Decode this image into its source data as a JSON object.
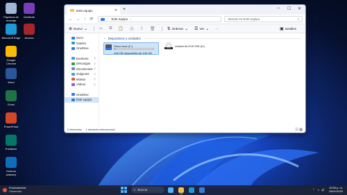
{
  "colors": {
    "accent": "#2c7be5",
    "selection": "#cde4fb",
    "taskbar": "#1c2337"
  },
  "desktop": {
    "icons": [
      {
        "label": "Papelera de reciclaje",
        "icon": "recycle-bin-icon",
        "color": "#9fb6d6"
      },
      {
        "label": "OneNote",
        "icon": "onenote-icon",
        "color": "#7a3db8"
      },
      {
        "label": "Microsoft Edge",
        "icon": "edge-icon",
        "color": "#1d9ad6"
      },
      {
        "label": "Access",
        "icon": "access-icon",
        "color": "#a4262c"
      },
      {
        "label": "Google Chrome",
        "icon": "chrome-icon",
        "color": "#fbbc05"
      },
      {
        "label": "Word",
        "icon": "word-icon",
        "color": "#2b579a"
      },
      {
        "label": "Excel",
        "icon": "excel-icon",
        "color": "#217346"
      },
      {
        "label": "PowerPoint",
        "icon": "powerpoint-icon",
        "color": "#d24726"
      },
      {
        "label": "Publisher",
        "icon": "publisher-icon",
        "color": "#077568"
      },
      {
        "label": "Outlook (classic)",
        "icon": "outlook-icon",
        "color": "#0f6cbd"
      }
    ]
  },
  "explorer": {
    "tab_title": "Este equipo",
    "address": {
      "location": "Este equipo"
    },
    "search_placeholder": "Buscar en Este equipo",
    "toolbar": {
      "new_label": "Nuevo",
      "sort_label": "Ordenar",
      "view_label": "Ver",
      "more_label": "···",
      "details_label": "Detalles"
    },
    "sidebar": {
      "top": [
        {
          "label": "Inicio",
          "icon": "home-icon",
          "color": "#2c7be5"
        },
        {
          "label": "Galería",
          "icon": "gallery-icon",
          "color": "#27a0c8"
        },
        {
          "label": "OneDrive",
          "icon": "onedrive-icon",
          "color": "#2c7be5"
        }
      ],
      "quick": [
        {
          "label": "Escritorio",
          "icon": "desktop-folder-icon",
          "color": "#3aa0e8"
        },
        {
          "label": "Descargas",
          "icon": "downloads-folder-icon",
          "color": "#2f9a57"
        },
        {
          "label": "Documentos",
          "icon": "documents-folder-icon",
          "color": "#7a8aa0"
        },
        {
          "label": "Imágenes",
          "icon": "pictures-folder-icon",
          "color": "#3aa0e8"
        },
        {
          "label": "Música",
          "icon": "music-folder-icon",
          "color": "#e0574f"
        },
        {
          "label": "Vídeos",
          "icon": "videos-folder-icon",
          "color": "#8a5cd1"
        }
      ],
      "bottom": [
        {
          "label": "OneDrive",
          "icon": "onedrive-icon",
          "color": "#2c7be5"
        },
        {
          "label": "Este equipo",
          "icon": "this-pc-icon",
          "color": "#2c7be5"
        }
      ]
    },
    "content": {
      "group_title": "Dispositivos y unidades",
      "drives": [
        {
          "name": "Disco local (C:)",
          "free_text": "438 GB disponibles de 440 GB",
          "used_fraction": 0.005
        },
        {
          "name": "Unidad de DVD RW (D:)"
        }
      ]
    },
    "status": {
      "count": "2 elementos",
      "selected": "1 elemento seleccionado"
    }
  },
  "taskbar": {
    "weather": {
      "title": "Próximamente",
      "subtitle": "Ganancias"
    },
    "search_label": "Buscar",
    "apps": [
      {
        "icon": "copilot-icon",
        "color": "#4fb3ff"
      },
      {
        "icon": "file-explorer-icon",
        "color": "#f2c14e"
      },
      {
        "icon": "edge-icon",
        "color": "#1d9ad6"
      },
      {
        "icon": "store-icon",
        "color": "#3a7bd5"
      }
    ],
    "tray": {
      "time": "10:59 p. m.",
      "date": "26/01/2025"
    }
  }
}
